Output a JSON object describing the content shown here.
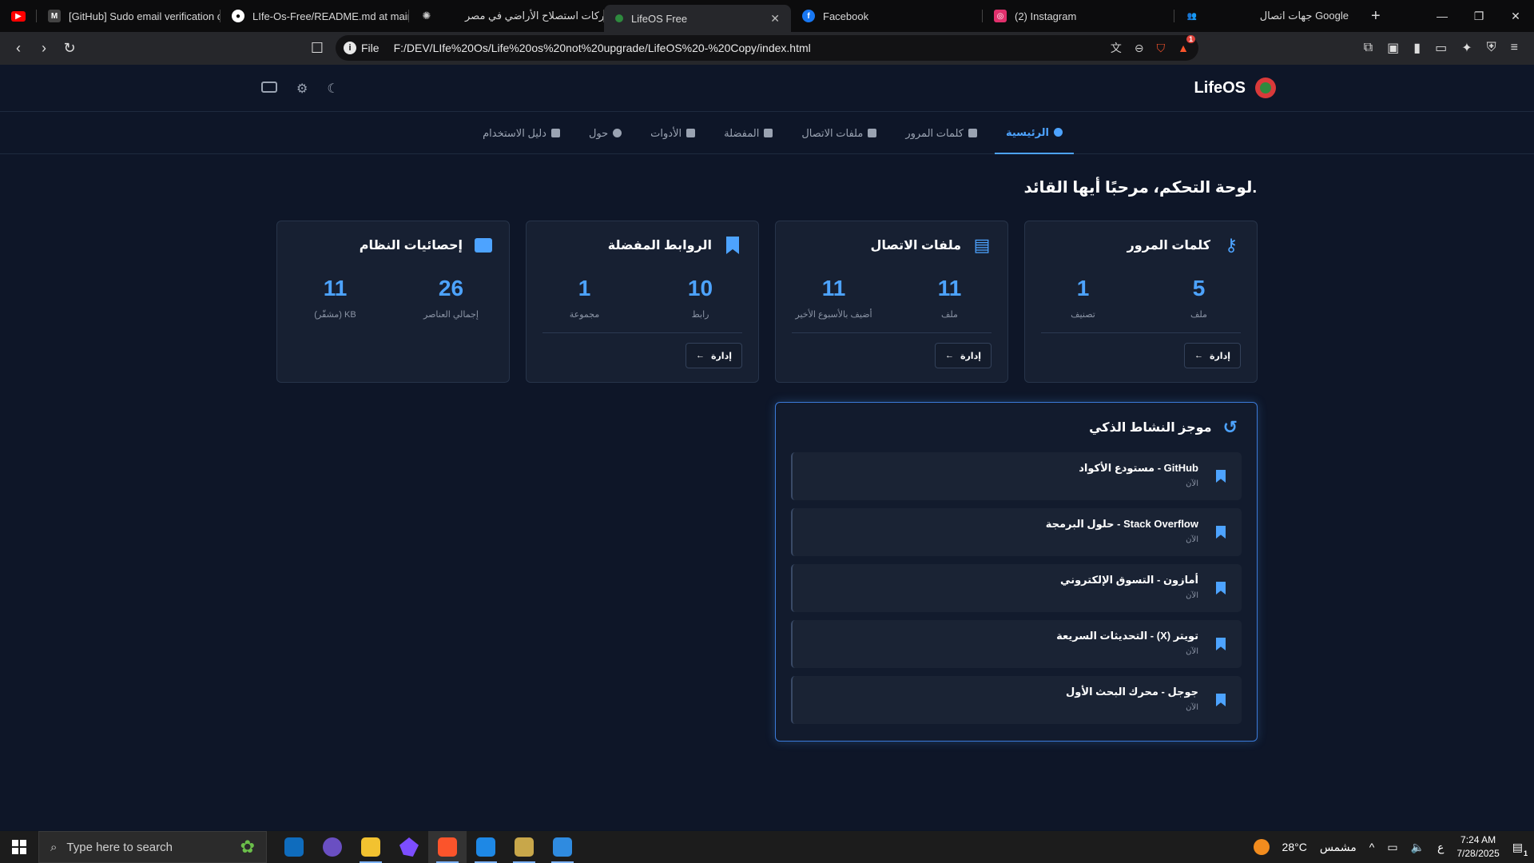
{
  "browser": {
    "tabs": [
      {
        "title": "",
        "icon": "youtube-icon",
        "color": "#ff0000"
      },
      {
        "title": "[GitHub] Sudo email verification cod",
        "icon": "gmail-icon",
        "color": "#ea4335"
      },
      {
        "title": "LIfe-Os-Free/README.md at main ·",
        "icon": "github-icon",
        "color": "#ffffff"
      },
      {
        "title": "شركات استصلاح الأراضي في مصر",
        "icon": "openai-icon",
        "color": "#cccccc"
      },
      {
        "title": "LifeOS Free",
        "icon": "lifeos-icon",
        "color": "#2e8a3e",
        "active": true
      },
      {
        "title": "Facebook",
        "icon": "facebook-icon",
        "color": "#1877f2"
      },
      {
        "title": "(2) Instagram",
        "icon": "instagram-icon",
        "color": "#e1306c"
      },
      {
        "title": "جهات اتصال Google",
        "icon": "google-contacts-icon",
        "color": "#4285f4"
      }
    ],
    "url_scheme": "File",
    "url": "F:/DEV/LIfe%20Os/Life%20os%20not%20upgrade/LifeOS%20-%20Copy/index.html",
    "brave_badge": "1"
  },
  "app": {
    "brand": "LifeOS",
    "nav": [
      {
        "label": "الرئيسية",
        "icon": "home-icon",
        "active": true
      },
      {
        "label": "كلمات المرور",
        "icon": "key-icon"
      },
      {
        "label": "ملفات الاتصال",
        "icon": "contact-book-icon"
      },
      {
        "label": "المفضلة",
        "icon": "bookmark-icon"
      },
      {
        "label": "الأدوات",
        "icon": "tools-icon"
      },
      {
        "label": "حول",
        "icon": "info-icon"
      },
      {
        "label": "دليل الاستخدام",
        "icon": "guide-icon"
      }
    ],
    "heading": "لوحة التحكم، مرحبًا أيها القائد.",
    "cards": [
      {
        "title": "كلمات المرور",
        "icon": "key-icon",
        "stats": [
          {
            "num": "5",
            "label": "ملف"
          },
          {
            "num": "1",
            "label": "تصنيف"
          }
        ],
        "button": "إدارة"
      },
      {
        "title": "ملفات الاتصال",
        "icon": "contact-book-icon",
        "stats": [
          {
            "num": "11",
            "label": "ملف"
          },
          {
            "num": "11",
            "label": "أضيف بالأسبوع الأخير"
          }
        ],
        "button": "إدارة"
      },
      {
        "title": "الروابط المفضلة",
        "icon": "bookmark-icon",
        "stats": [
          {
            "num": "10",
            "label": "رابط"
          },
          {
            "num": "1",
            "label": "مجموعة"
          }
        ],
        "button": "إدارة"
      },
      {
        "title": "إحصائيات النظام",
        "icon": "server-icon",
        "stats": [
          {
            "num": "26",
            "label": "إجمالي العناصر"
          },
          {
            "num": "11",
            "label": "KB (مشفّر)"
          }
        ],
        "button": ""
      }
    ],
    "activity": {
      "title": "موجز النشاط الذكي",
      "items": [
        {
          "title": "GitHub - مستودع الأكواد",
          "time": "الآن"
        },
        {
          "title": "Stack Overflow - حلول البرمجة",
          "time": "الآن"
        },
        {
          "title": "أمازون - التسوق الإلكتروني",
          "time": "الآن"
        },
        {
          "title": "تويتر (X) - التحديثات السريعة",
          "time": "الآن"
        },
        {
          "title": "جوجل - محرك البحث الأول",
          "time": "الآن"
        }
      ]
    }
  },
  "taskbar": {
    "search_placeholder": "Type here to search",
    "weather_temp": "28°C",
    "weather_text": "مشمس",
    "lang": "ع",
    "time": "7:24 AM",
    "date": "7/28/2025",
    "notif_count": "1"
  }
}
